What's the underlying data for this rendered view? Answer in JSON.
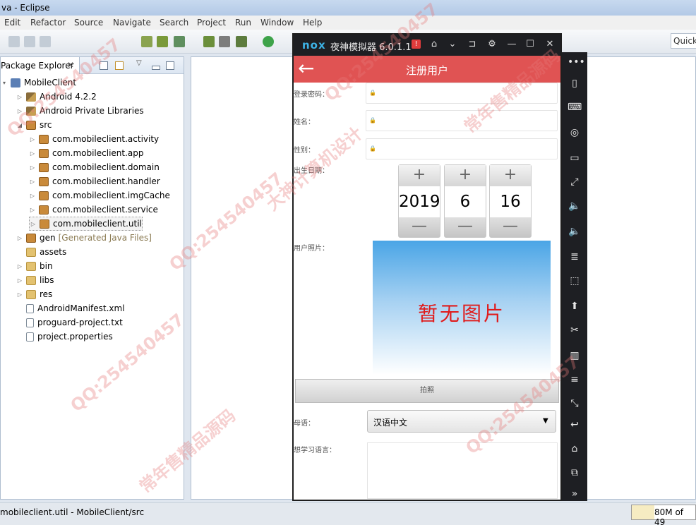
{
  "window": {
    "title": "va - Eclipse"
  },
  "menu": [
    "Edit",
    "Refactor",
    "Source",
    "Navigate",
    "Search",
    "Project",
    "Run",
    "Window",
    "Help"
  ],
  "quick_access": "Quick",
  "package_explorer": {
    "tab_label": "Package Explorer",
    "tab_close": "✕",
    "tree": [
      {
        "label": "MobileClient",
        "icon": "project-icon",
        "twisty": "▾",
        "depth": 0
      },
      {
        "label": "Android 4.2.2",
        "icon": "library-icon",
        "twisty": "▷",
        "depth": 1
      },
      {
        "label": "Android Private Libraries",
        "icon": "library-icon",
        "twisty": "▷",
        "depth": 1
      },
      {
        "label": "src",
        "icon": "source-folder-icon",
        "twisty": "◢",
        "depth": 1
      },
      {
        "label": "com.mobileclient.activity",
        "icon": "package-icon",
        "twisty": "▷",
        "depth": 2
      },
      {
        "label": "com.mobileclient.app",
        "icon": "package-icon",
        "twisty": "▷",
        "depth": 2
      },
      {
        "label": "com.mobileclient.domain",
        "icon": "package-icon",
        "twisty": "▷",
        "depth": 2
      },
      {
        "label": "com.mobileclient.handler",
        "icon": "package-icon",
        "twisty": "▷",
        "depth": 2
      },
      {
        "label": "com.mobileclient.imgCache",
        "icon": "package-icon",
        "twisty": "▷",
        "depth": 2
      },
      {
        "label": "com.mobileclient.service",
        "icon": "package-icon",
        "twisty": "▷",
        "depth": 2
      },
      {
        "label": "com.mobileclient.util",
        "icon": "package-icon",
        "twisty": "▷",
        "depth": 2
      },
      {
        "label": "gen",
        "suffix": "[Generated Java Files]",
        "icon": "source-folder-icon",
        "twisty": "▷",
        "depth": 1
      },
      {
        "label": "assets",
        "icon": "folder-icon",
        "twisty": "",
        "depth": 1
      },
      {
        "label": "bin",
        "icon": "folder-icon",
        "twisty": "▷",
        "depth": 1
      },
      {
        "label": "libs",
        "icon": "folder-icon",
        "twisty": "▷",
        "depth": 1
      },
      {
        "label": "res",
        "icon": "folder-icon",
        "twisty": "▷",
        "depth": 1
      },
      {
        "label": "AndroidManifest.xml",
        "icon": "xml-file-icon",
        "twisty": "",
        "depth": 1
      },
      {
        "label": "proguard-project.txt",
        "icon": "text-file-icon",
        "twisty": "",
        "depth": 1
      },
      {
        "label": "project.properties",
        "icon": "text-file-icon",
        "twisty": "",
        "depth": 1
      }
    ]
  },
  "status": {
    "text": "mobileclient.util - MobileClient/src",
    "memory": "80M of 49",
    "memory_fill": 0.35
  },
  "nox": {
    "logo": "nox",
    "title": "夜神模拟器 6.0.1.1",
    "warn": "!",
    "window_buttons": [
      "⌂",
      "⌄",
      "⊐",
      "⚙",
      "—",
      "☐",
      "✕"
    ],
    "app": {
      "title": "注册用户",
      "back": "←",
      "fields": {
        "password_label": "登录密码：",
        "name_label": "姓名：",
        "gender_label": "性别：",
        "birth_label": "出生日期：",
        "photo_label": "用户照片："
      },
      "date": {
        "year": "2019",
        "month": "6",
        "day": "16",
        "plus": "+",
        "minus": "—"
      },
      "photo_placeholder": "暂无图片",
      "take_photo": "拍照",
      "mother_tongue_label": "母语：",
      "mother_tongue_value": "汉语中文",
      "learn_label": "想学习语言："
    },
    "sidebar": [
      "•••",
      "▯",
      "⌨",
      "◎",
      "▭",
      "⤢",
      "🔈",
      "🔈",
      "≣",
      "⬚",
      "⬆",
      "✂",
      "▥",
      "≡",
      "⤡",
      "↩",
      "⌂",
      "⧉",
      "»"
    ]
  },
  "watermark": [
    "QQ:254540457",
    "大神计算机设计",
    "常年售精品源码"
  ]
}
